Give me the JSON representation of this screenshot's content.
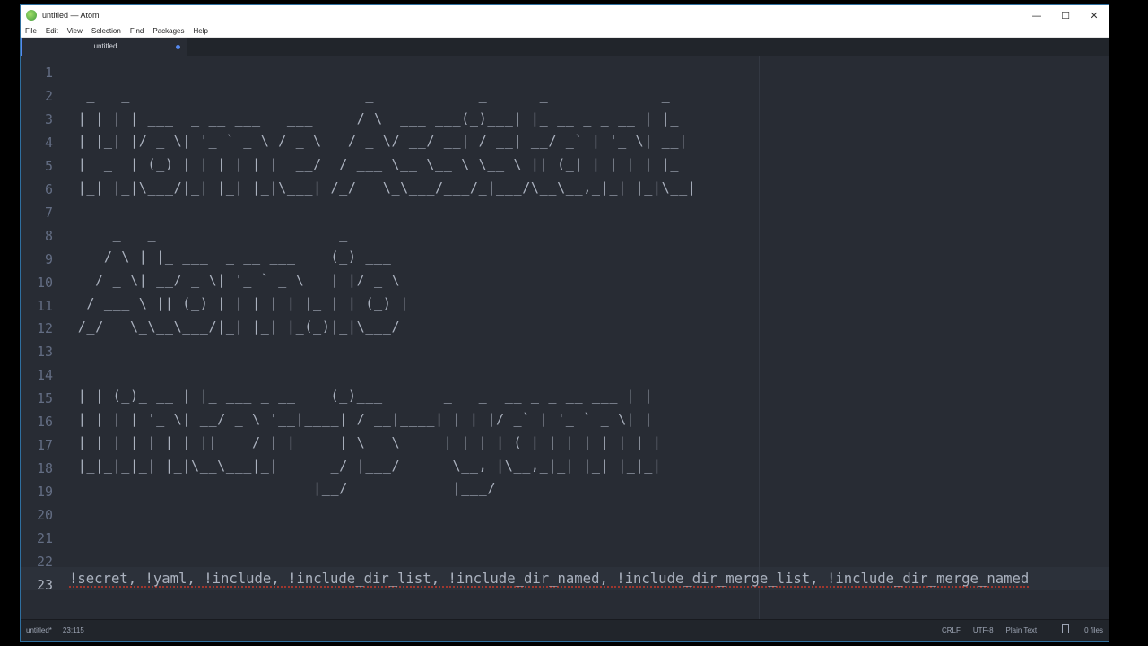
{
  "window": {
    "title": "untitled — Atom",
    "controls": {
      "minimize": "—",
      "maximize": "☐",
      "close": "✕"
    }
  },
  "menu": [
    "File",
    "Edit",
    "View",
    "Selection",
    "Find",
    "Packages",
    "Help"
  ],
  "tab": {
    "label": "untitled",
    "modified": true
  },
  "editor": {
    "line_numbers": [
      "1",
      "2",
      "3",
      "4",
      "5",
      "6",
      "7",
      "8",
      "9",
      "10",
      "11",
      "12",
      "13",
      "14",
      "15",
      "16",
      "17",
      "18",
      "19",
      "20",
      "21",
      "22",
      "23"
    ],
    "active_line": 23,
    "lines": [
      "",
      "  _   _                           _            _      _             _",
      " | | | | ___  _ __ ___   ___     / \\  ___ ___(_)___| |_ __ _ _ __ | |_",
      " | |_| |/ _ \\| '_ ` _ \\ / _ \\   / _ \\/ __/ __| / __| __/ _` | '_ \\| __|",
      " |  _  | (_) | | | | | |  __/  / ___ \\__ \\__ \\ \\__ \\ || (_| | | | | |_",
      " |_| |_|\\___/|_| |_| |_|\\___| /_/   \\_\\___/___/_|___/\\__\\__,_|_| |_|\\__|",
      "",
      "     _   _                     _",
      "    / \\ | |_ ___  _ __ ___    (_) ___",
      "   / _ \\| __/ _ \\| '_ ` _ \\   | |/ _ \\",
      "  / ___ \\ || (_) | | | | | |_ | | (_) |",
      " /_/   \\_\\__\\___/|_| |_| |_(_)|_|\\___/",
      "",
      "  _   _       _            _                                   _",
      " | | (_)_ __ | |_ ___ _ __    (_)___       _   _  __ _ _ __ ___ | |",
      " | | | | '_ \\| __/ _ \\ '__|____| / __|____| | | |/ _` | '_ ` _ \\| |",
      " | | | | | | | ||  __/ | |_____| \\__ \\_____| |_| | (_| | | | | | | |",
      " |_|_|_|_| |_|\\__\\___|_|      _/ |___/      \\__, |\\__,_|_| |_| |_|_|",
      "                            |__/            |___/",
      "",
      "",
      ""
    ],
    "last_line": "!secret, !yaml, !include, !include_dir_list, !include_dir_named, !include_dir_merge_list, !include_dir_merge_named"
  },
  "status": {
    "file": "untitled*",
    "cursor": "23:115",
    "line_ending": "CRLF",
    "encoding": "UTF-8",
    "grammar": "Plain Text",
    "files": "0 files"
  },
  "colors": {
    "editor_bg": "#282c34",
    "accent": "#568af2",
    "text": "#abb2bf"
  }
}
